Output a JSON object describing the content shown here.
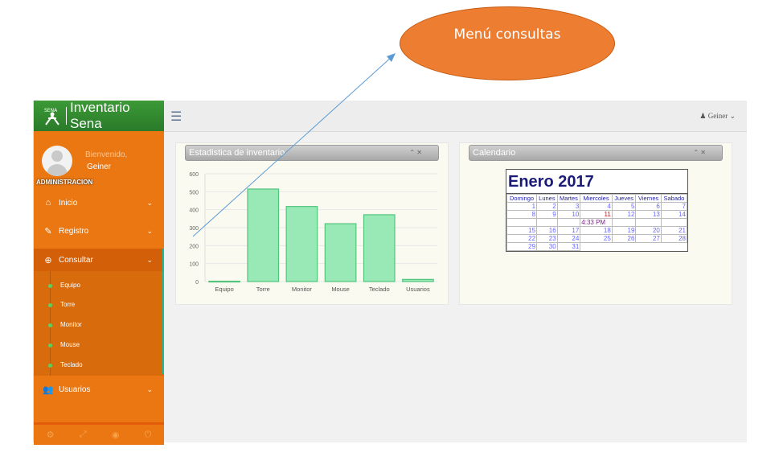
{
  "callout": {
    "label": "Menú consultas"
  },
  "sidebar": {
    "brand": "Inventario Sena",
    "welcome": "Bienvenido,",
    "username": "Geiner",
    "role": "ADMINISTRACION",
    "items": [
      {
        "label": "Inicio",
        "icon": "home-icon"
      },
      {
        "label": "Registro",
        "icon": "edit-icon"
      },
      {
        "label": "Consultar",
        "icon": "search-plus-icon"
      },
      {
        "label": "Usuarios",
        "icon": "users-icon"
      }
    ],
    "subitems": [
      "Equipo",
      "Torre",
      "Monitor",
      "Mouse",
      "Teclado"
    ]
  },
  "topbar": {
    "user": "Geiner"
  },
  "stats_panel": {
    "title": "Estadistica de inventario"
  },
  "calendar_panel": {
    "title": "Calendario"
  },
  "calendar": {
    "month": "Enero 2017",
    "days": [
      "Domingo",
      "Lunes",
      "Martes",
      "Miercoles",
      "Jueves",
      "Viernes",
      "Sabado"
    ],
    "weeks": [
      [
        "",
        "",
        "",
        "",
        "",
        "",
        ""
      ]
    ],
    "time": "4:33 PM",
    "today": "11"
  },
  "chart_data": {
    "type": "bar",
    "categories": [
      "Equipo",
      "Torre",
      "Monitor",
      "Mouse",
      "Teclado",
      "Usuarios"
    ],
    "values": [
      2,
      515,
      418,
      322,
      372,
      12
    ],
    "ylim": [
      0,
      600
    ],
    "yticks": [
      0,
      100,
      200,
      300,
      400,
      500,
      600
    ],
    "colors": {
      "fill": "#98e9b6",
      "stroke": "#52c47e"
    }
  }
}
